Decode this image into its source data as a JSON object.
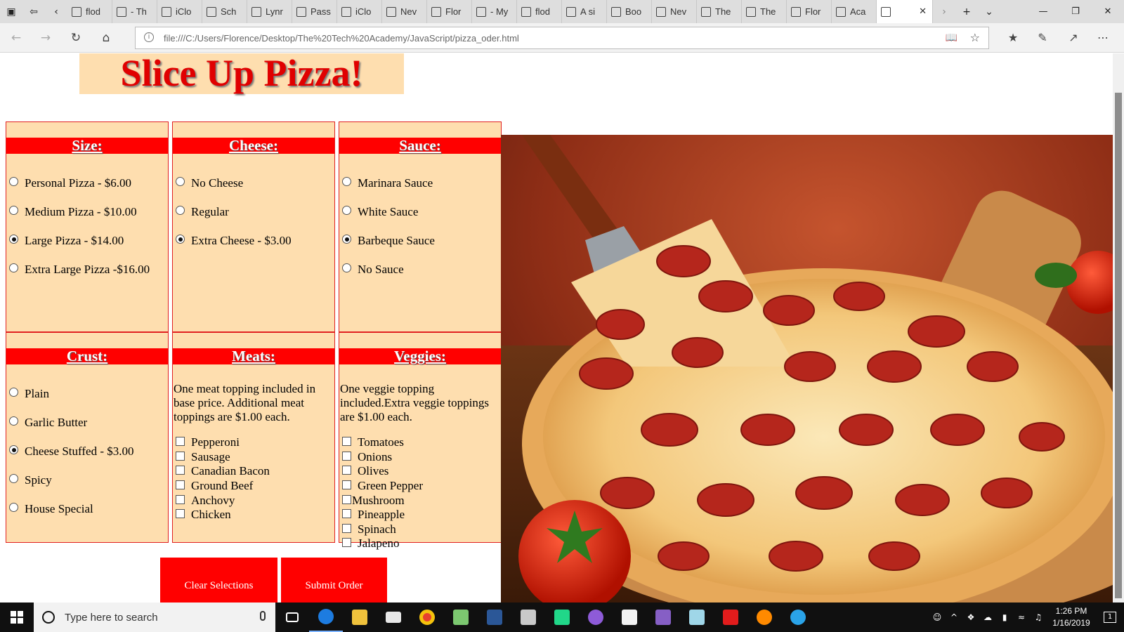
{
  "browser": {
    "tabs": [
      {
        "label": "flod"
      },
      {
        "label": "- Th"
      },
      {
        "label": "iClo"
      },
      {
        "label": "Sch"
      },
      {
        "label": "Lynr"
      },
      {
        "label": "Pass"
      },
      {
        "label": "iClo"
      },
      {
        "label": "Nev"
      },
      {
        "label": "Flor"
      },
      {
        "label": "- My"
      },
      {
        "label": "flod"
      },
      {
        "label": "A si"
      },
      {
        "label": "Boo"
      },
      {
        "label": "Nev"
      },
      {
        "label": "The"
      },
      {
        "label": "The"
      },
      {
        "label": "Flor"
      },
      {
        "label": "Aca"
      }
    ],
    "url": "file:///C:/Users/Florence/Desktop/The%20Tech%20Academy/JavaScript/pizza_oder.html"
  },
  "page": {
    "title": "Slice Up Pizza!",
    "size": {
      "heading": "Size:",
      "options": [
        {
          "label": "Personal Pizza - $6.00",
          "checked": false
        },
        {
          "label": "Medium Pizza - $10.00",
          "checked": false
        },
        {
          "label": "Large Pizza - $14.00",
          "checked": true
        },
        {
          "label": "Extra Large Pizza -$16.00",
          "checked": false
        }
      ]
    },
    "cheese": {
      "heading": "Cheese:",
      "options": [
        {
          "label": "No Cheese",
          "checked": false
        },
        {
          "label": "Regular",
          "checked": false
        },
        {
          "label": "Extra Cheese - $3.00",
          "checked": true
        }
      ]
    },
    "sauce": {
      "heading": "Sauce:",
      "options": [
        {
          "label": "Marinara Sauce",
          "checked": false
        },
        {
          "label": "White Sauce",
          "checked": false
        },
        {
          "label": "Barbeque Sauce",
          "checked": true
        },
        {
          "label": "No Sauce",
          "checked": false
        }
      ]
    },
    "crust": {
      "heading": "Crust:",
      "options": [
        {
          "label": "Plain",
          "checked": false
        },
        {
          "label": "Garlic Butter",
          "checked": false
        },
        {
          "label": "Cheese Stuffed - $3.00",
          "checked": true
        },
        {
          "label": "Spicy",
          "checked": false
        },
        {
          "label": "House Special",
          "checked": false
        }
      ]
    },
    "meats": {
      "heading": "Meats:",
      "note": "One meat topping included in base price. Additional meat toppings are $1.00 each.",
      "items": [
        "Pepperoni",
        "Sausage",
        "Canadian Bacon",
        "Ground Beef",
        "Anchovy",
        "Chicken"
      ]
    },
    "veggies": {
      "heading": "Veggies:",
      "note": "One veggie topping included.Extra veggie toppings are $1.00 each.",
      "items": [
        "Tomatoes",
        "Onions",
        "Olives",
        "Green Pepper",
        "Mushroom",
        "Pineapple",
        "Spinach",
        "Jalapeno"
      ]
    },
    "buttons": {
      "clear": "Clear Selections",
      "submit": "Submit Order"
    }
  },
  "taskbar": {
    "search_placeholder": "Type here to search",
    "time": "1:26 PM",
    "date": "1/16/2019",
    "notification_count": "1"
  },
  "colors": {
    "accent_red": "#ff0000",
    "panel_peach": "#fedeaf",
    "title_red": "#e00000"
  }
}
